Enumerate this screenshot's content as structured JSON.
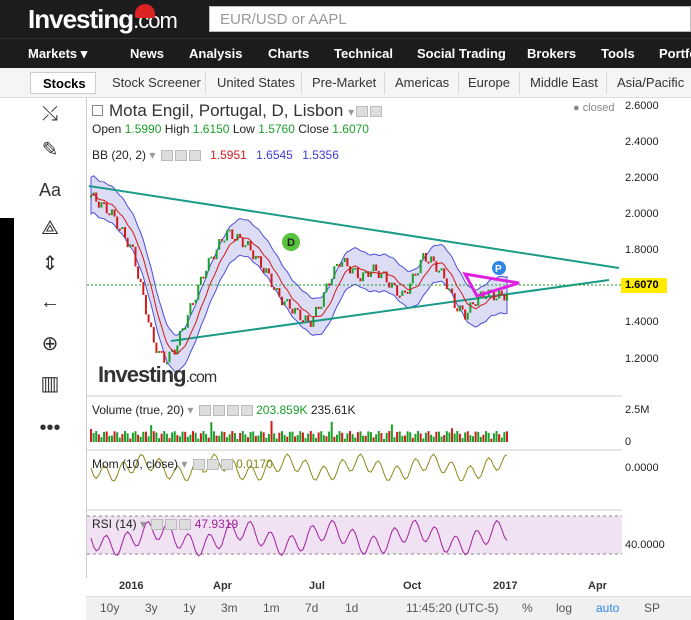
{
  "header": {
    "logo_text": "Investing",
    "logo_suffix": ".com",
    "search_placeholder": "EUR/USD or AAPL"
  },
  "nav": {
    "items": [
      "Markets",
      "News",
      "Analysis",
      "Charts",
      "Technical",
      "Social Trading",
      "Brokers",
      "Tools",
      "Portfo"
    ]
  },
  "subnav": {
    "items": [
      "Stocks",
      "Stock Screener",
      "United States",
      "Pre-Market",
      "Americas",
      "Europe",
      "Middle East",
      "Asia/Pacific"
    ]
  },
  "chart": {
    "title": "Mota Engil, Portugal, D, Lisbon",
    "status": "closed",
    "ohlc": {
      "open_label": "Open",
      "open": "1.5990",
      "high_label": "High",
      "high": "1.6150",
      "low_label": "Low",
      "low": "1.5760",
      "close_label": "Close",
      "close": "1.6070"
    },
    "bb": {
      "label": "BB (20, 2)",
      "v1": "1.5951",
      "v2": "1.6545",
      "v3": "1.5356"
    },
    "volume": {
      "label": "Volume (true, 20)",
      "v1": "203.859K",
      "v2": "235.61K"
    },
    "mom": {
      "label": "Mom (10, close)",
      "v": "0.0170"
    },
    "rsi": {
      "label": "RSI (14)",
      "v": "47.9319"
    },
    "watermark": "Investing",
    "watermark_suffix": ".com",
    "marker_d": "D",
    "marker_p": "P",
    "current_price": "1.6070"
  },
  "chart_data": {
    "type": "line",
    "title": "Mota Engil, Portugal, D, Lisbon",
    "y_ticks": [
      "2.6000",
      "2.4000",
      "2.2000",
      "2.0000",
      "1.8000",
      "1.6070",
      "1.4000",
      "1.2000"
    ],
    "x_ticks": [
      "2016",
      "Apr",
      "Jul",
      "Oct",
      "2017",
      "Apr"
    ],
    "ylim": [
      1.1,
      2.65
    ],
    "volume_ticks": [
      "2.5M",
      "0"
    ],
    "mom_ticks": [
      "0.0000"
    ],
    "rsi_ticks": [
      "40.0000"
    ],
    "price_series": [
      2.15,
      2.1,
      2.05,
      1.95,
      1.85,
      1.6,
      1.35,
      1.25,
      1.3,
      1.45,
      1.6,
      1.75,
      1.85,
      1.95,
      1.92,
      1.88,
      1.8,
      1.72,
      1.6,
      1.55,
      1.5,
      1.45,
      1.55,
      1.7,
      1.8,
      1.75,
      1.7,
      1.75,
      1.72,
      1.65,
      1.6,
      1.7,
      1.82,
      1.78,
      1.7,
      1.55,
      1.5,
      1.58,
      1.62,
      1.6,
      1.61
    ]
  },
  "bottom": {
    "ranges": [
      "10y",
      "3y",
      "1y",
      "3m",
      "1m",
      "7d",
      "1d"
    ],
    "time": "11:45:20 (UTC-5)",
    "opts": [
      "%",
      "log",
      "auto",
      "SP"
    ]
  },
  "colors": {
    "accent": "#0a66c2",
    "up": "#1a9f29",
    "down": "#d01b1b",
    "trend": "#1b9b87",
    "bb_fill": "#d9d9f5",
    "magenta": "#e020e0"
  }
}
